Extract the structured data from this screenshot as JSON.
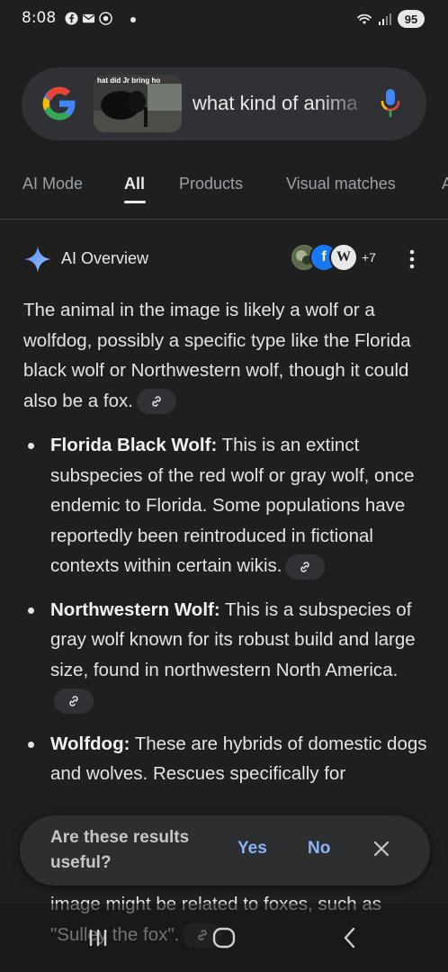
{
  "status": {
    "time": "8:08",
    "battery": "95",
    "left_icons": [
      "facebook-icon",
      "mail-icon",
      "media-icon"
    ],
    "right_icons": [
      "wifi-icon",
      "signal-icon",
      "battery-icon"
    ]
  },
  "search": {
    "query": "what kind of anima",
    "thumbnail_caption": "hat did Jr bring ho",
    "logo": "google-logo",
    "mic": "mic-icon"
  },
  "tabs": [
    {
      "label": "AI Mode",
      "active": false
    },
    {
      "label": "All",
      "active": true
    },
    {
      "label": "Products",
      "active": false
    },
    {
      "label": "Visual matches",
      "active": false
    },
    {
      "label": "A",
      "active": false
    }
  ],
  "ai_overview": {
    "title": "AI Overview",
    "sources_more": "+7",
    "intro": "The animal in the image is likely a wolf or a wolfdog, possibly a specific type like the Florida black wolf or Northwestern wolf, though it could also be a fox.",
    "bullets": [
      {
        "term": "Florida Black Wolf:",
        "text": " This is an extinct subspecies of the red wolf or gray wolf, once endemic to Florida. Some populations have reportedly been reintroduced in fictional contexts within certain wikis."
      },
      {
        "term": "Northwestern Wolf:",
        "text": " This is a subspecies of gray wolf known for its robust build and large size, found in northwestern North America."
      },
      {
        "term": "Wolfdog:",
        "text": " These are hybrids of domestic dogs and wolves. Rescues specifically for"
      }
    ],
    "partial_text": "image might be related to foxes, such as \"Sulley the fox\"."
  },
  "feedback": {
    "question": "Are these results useful?",
    "yes": "Yes",
    "no": "No"
  },
  "colors": {
    "background": "#1f1f1f",
    "accent_link": "#8ab4f8",
    "surface": "#303134"
  }
}
